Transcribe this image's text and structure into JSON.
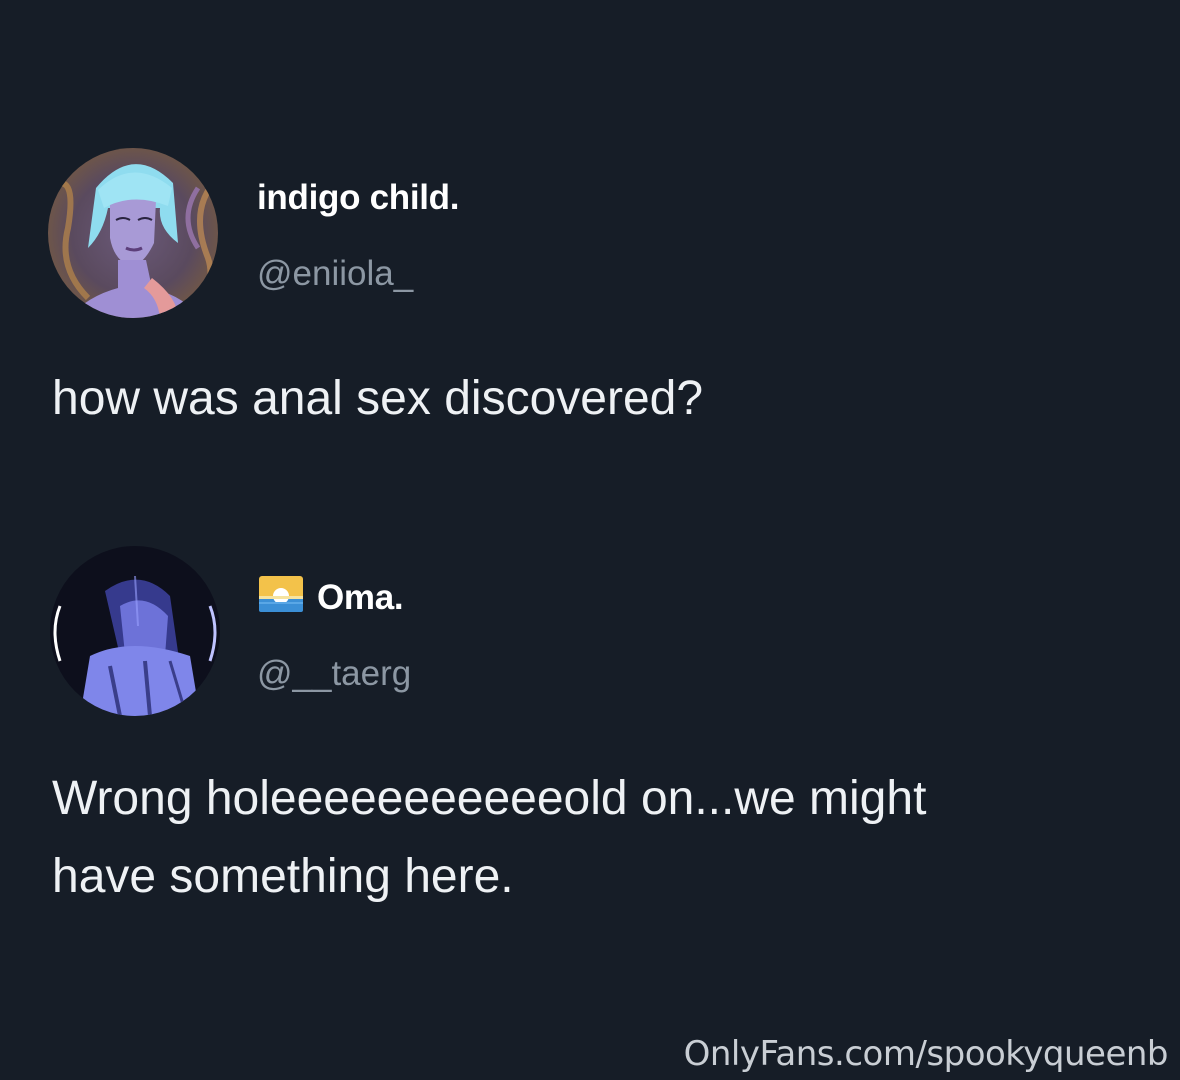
{
  "tweets": [
    {
      "display_name": "indigo child.",
      "handle": "@eniiola_",
      "text": "how was anal sex discovered?",
      "avatar_icon": "illustrated-woman-blue-hair-avatar"
    },
    {
      "display_name": "Oma.",
      "handle": "@__taerg",
      "text_lines": [
        "Wrong holeeeeeeeeeeeold on...we might",
        "have something here."
      ],
      "avatar_icon": "dark-blue-photo-avatar",
      "name_emoji": "sunrise-flag-emoji"
    }
  ],
  "watermark": "OnlyFans.com/spookyqueenb",
  "colors": {
    "background": "#161d27",
    "name": "#ffffff",
    "handle": "#8c97a3",
    "text": "#eef1f4"
  }
}
